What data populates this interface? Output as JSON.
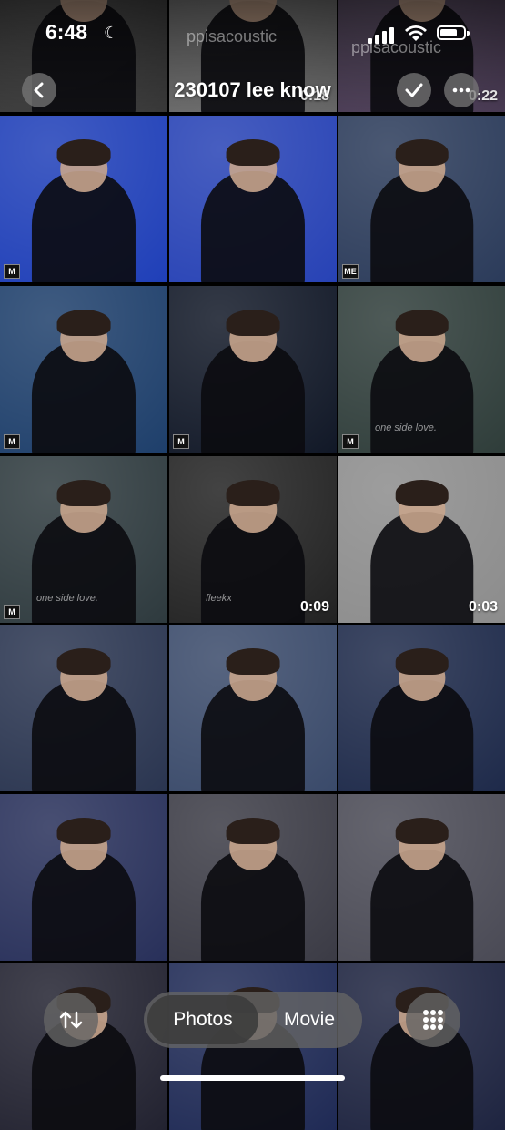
{
  "status": {
    "time": "6:48"
  },
  "header": {
    "title": "230107 lee know",
    "watermark": "ppisacoustic"
  },
  "grid": {
    "rows": [
      [
        {
          "bg": "#3a3a3a",
          "duration": ""
        },
        {
          "bg": "#6a6a6a",
          "duration": "0:18"
        },
        {
          "bg": "#4a3b55",
          "duration": "0:22"
        }
      ],
      [
        {
          "bg": "#1f3fb8",
          "badge": "M",
          "duration": ""
        },
        {
          "bg": "#2742b5",
          "duration": ""
        },
        {
          "bg": "#2b3b5a",
          "badge": "ME",
          "duration": ""
        }
      ],
      [
        {
          "bg": "#1e3f6b",
          "badge": "M",
          "duration": ""
        },
        {
          "bg": "#111827",
          "badge": "M",
          "duration": ""
        },
        {
          "bg": "#2f3d3a",
          "badge": "M",
          "caption": "one side love.",
          "duration": ""
        }
      ],
      [
        {
          "bg": "#2e3a3e",
          "badge": "M",
          "caption": "one side love.",
          "duration": ""
        },
        {
          "bg": "#222222",
          "caption": "fleekx",
          "duration": "0:09"
        },
        {
          "bg": "#8c8c8c",
          "duration": "0:03"
        }
      ],
      [
        {
          "bg": "#2a3550",
          "duration": ""
        },
        {
          "bg": "#3a4a6a",
          "duration": ""
        },
        {
          "bg": "#1e2a4a",
          "duration": ""
        }
      ],
      [
        {
          "bg": "#28305a",
          "duration": ""
        },
        {
          "bg": "#3b3b45",
          "duration": ""
        },
        {
          "bg": "#4a4a55",
          "duration": ""
        }
      ],
      [
        {
          "bg": "#222230",
          "duration": ""
        },
        {
          "bg": "#1f2a55",
          "duration": ""
        },
        {
          "bg": "#1e2440",
          "duration": ""
        }
      ]
    ]
  },
  "bottom_bar": {
    "photos_label": "Photos",
    "movie_label": "Movie",
    "sort_icon": "arrow-up-down-icon",
    "grid_icon": "grid-icon"
  }
}
